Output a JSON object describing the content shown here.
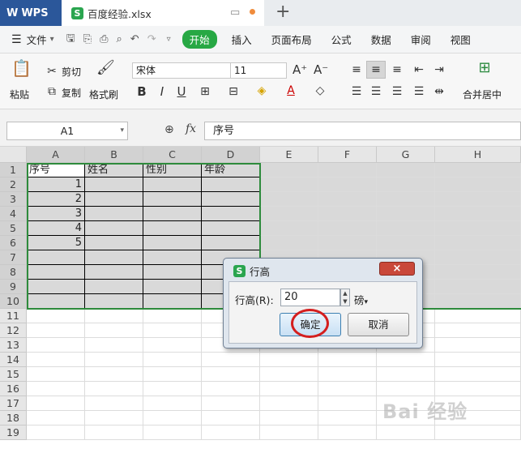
{
  "titlebar": {
    "app_name": "WPS",
    "file_name": "百度经验.xlsx",
    "new_tab": "+"
  },
  "menu": {
    "items": [
      "文件",
      "开始",
      "插入",
      "页面布局",
      "公式",
      "数据",
      "审阅",
      "视图"
    ]
  },
  "ribbon": {
    "paste": "粘贴",
    "cut": "剪切",
    "copy": "复制",
    "format_painter": "格式刷",
    "font_name": "宋体",
    "font_size": "11",
    "bold": "B",
    "italic": "I",
    "underline": "U",
    "merge_center": "合并居中"
  },
  "formula_bar": {
    "cell_ref": "A1",
    "fx": "fx",
    "content": "序号"
  },
  "sheet": {
    "columns": [
      "A",
      "B",
      "C",
      "D",
      "E",
      "F",
      "G",
      "H"
    ],
    "rows": [
      "1",
      "2",
      "3",
      "4",
      "5",
      "6",
      "7",
      "8",
      "9",
      "10",
      "11",
      "12",
      "13",
      "14",
      "15",
      "16",
      "17",
      "18",
      "19"
    ],
    "header_cells": [
      "序号",
      "姓名",
      "性别",
      "年龄"
    ],
    "values": [
      "1",
      "2",
      "3",
      "4",
      "5"
    ]
  },
  "dialog": {
    "title": "行高",
    "close": "×",
    "label": "行高(R):",
    "value": "20",
    "unit": "磅",
    "ok": "确定",
    "cancel": "取消"
  },
  "watermark": "Bai 经验"
}
